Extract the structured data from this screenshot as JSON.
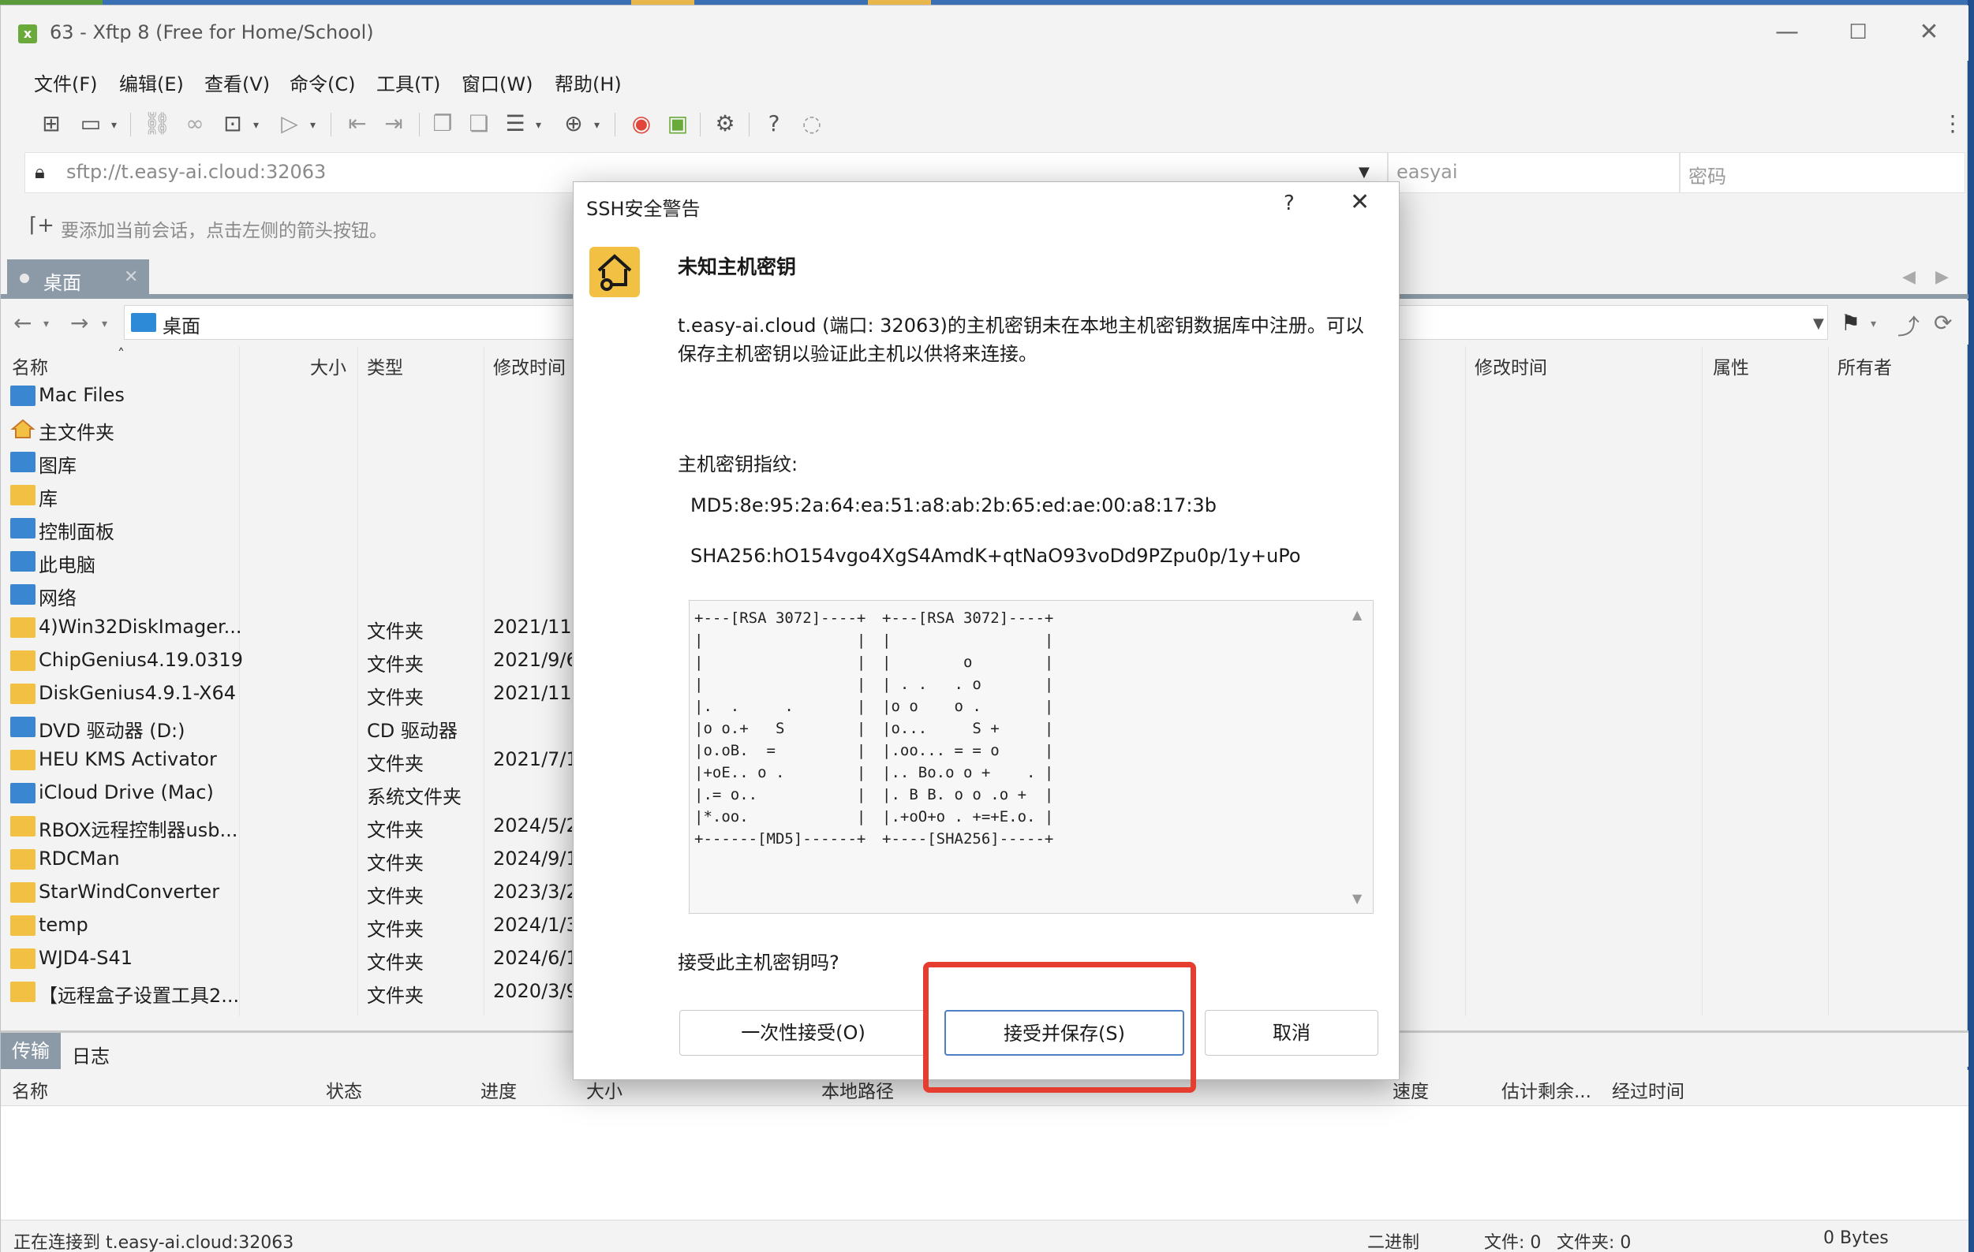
{
  "window": {
    "title": "63 - Xftp 8 (Free for Home/School)",
    "app_icon": "xftp-icon",
    "controls": [
      "—",
      "☐",
      "✕"
    ]
  },
  "menu": [
    "文件(F)",
    "编辑(E)",
    "查看(V)",
    "命令(C)",
    "工具(T)",
    "窗口(W)",
    "帮助(H)"
  ],
  "address": {
    "value": "sftp://t.easy-ai.cloud:32063",
    "username": "easyai",
    "password_placeholder": "密码"
  },
  "hint": "要添加当前会话，点击左侧的箭头按钮。",
  "tab": {
    "label": "桌面"
  },
  "path": {
    "label": "桌面"
  },
  "columns_left": [
    "名称",
    "大小",
    "类型",
    "修改时间"
  ],
  "columns_right": [
    "修改时间",
    "属性",
    "所有者"
  ],
  "files": [
    {
      "name": "Mac Files",
      "type": "",
      "date": "",
      "icon": "blue"
    },
    {
      "name": "主文件夹",
      "type": "",
      "date": "",
      "icon": "home"
    },
    {
      "name": "图库",
      "type": "",
      "date": "",
      "icon": "blue"
    },
    {
      "name": "库",
      "type": "",
      "date": "",
      "icon": "folder"
    },
    {
      "name": "控制面板",
      "type": "",
      "date": "",
      "icon": "blue"
    },
    {
      "name": "此电脑",
      "type": "",
      "date": "",
      "icon": "blue"
    },
    {
      "name": "网络",
      "type": "",
      "date": "",
      "icon": "blue"
    },
    {
      "name": "4)Win32DiskImager...",
      "type": "文件夹",
      "date": "2021/11/",
      "icon": "folder"
    },
    {
      "name": "ChipGenius4.19.0319",
      "type": "文件夹",
      "date": "2021/9/6",
      "icon": "folder"
    },
    {
      "name": "DiskGenius4.9.1-X64",
      "type": "文件夹",
      "date": "2021/11/",
      "icon": "folder"
    },
    {
      "name": "DVD 驱动器 (D:)",
      "type": "CD 驱动器",
      "date": "",
      "icon": "blue"
    },
    {
      "name": "HEU KMS Activator",
      "type": "文件夹",
      "date": "2021/7/1",
      "icon": "folder"
    },
    {
      "name": "iCloud Drive (Mac)",
      "type": "系统文件夹",
      "date": "",
      "icon": "blue"
    },
    {
      "name": "RBOX远程控制器usb...",
      "type": "文件夹",
      "date": "2024/5/2",
      "icon": "folder"
    },
    {
      "name": "RDCMan",
      "type": "文件夹",
      "date": "2024/9/1",
      "icon": "folder"
    },
    {
      "name": "StarWindConverter",
      "type": "文件夹",
      "date": "2023/3/2",
      "icon": "folder"
    },
    {
      "name": "temp",
      "type": "文件夹",
      "date": "2024/1/3",
      "icon": "folder"
    },
    {
      "name": "WJD4-S41",
      "type": "文件夹",
      "date": "2024/6/1",
      "icon": "folder"
    },
    {
      "name": "【远程盒子设置工具2...",
      "type": "文件夹",
      "date": "2020/3/9",
      "icon": "folder"
    }
  ],
  "bottom_tabs": [
    "传输",
    "日志"
  ],
  "transfer_columns": [
    "名称",
    "状态",
    "进度",
    "大小",
    "本地路径",
    "",
    "速度",
    "估计剩余...",
    "经过时间"
  ],
  "status": {
    "connecting": "正在连接到 t.easy-ai.cloud:32063",
    "mode": "二进制",
    "files": "文件: 0",
    "folders": "文件夹: 0",
    "bytes": "0 Bytes"
  },
  "dialog": {
    "title": "SSH安全警告",
    "help": "?",
    "close": "✕",
    "icon": "host-key-icon",
    "heading": "未知主机密钥",
    "body": "t.easy-ai.cloud (端口: 32063)的主机密钥未在本地主机密钥数据库中注册。可以保存主机密钥以验证此主机以供将来连接。",
    "fingerprint_label": "主机密钥指纹:",
    "md5": "MD5:8e:95:2a:64:ea:51:a8:ab:2b:65:ed:ae:00:a8:17:3b",
    "sha256": "SHA256:hO154vgo4XgS4AmdK+qtNaO93voDd9PZpu0p/1y+uPo",
    "art_md5": "+---[RSA 3072]----+\n|                 |\n|                 |\n|                 |\n|.  .     .       |\n|o o.+   S        |\n|o.oB.  =         |\n|+oE.. o .        |\n|.= o..           |\n|*.oo.            |\n+------[MD5]------+",
    "art_sha256": "+---[RSA 3072]----+\n|                 |\n|        o        |\n| . .   . o       |\n|o o    o .       |\n|o...     S +     |\n|.oo... = = o     |\n|.. Bo.o o +    . |\n|. B B. o o .o +  |\n|.+oO+o . +=+E.o. |\n+----[SHA256]-----+",
    "question": "接受此主机密钥吗?",
    "buttons": {
      "once": "一次性接受(O)",
      "accept_save": "接受并保存(S)",
      "cancel": "取消"
    }
  },
  "colors": {
    "accent": "#4c7fc4",
    "highlight": "#e53d2f",
    "tab": "#8c9aa8"
  }
}
